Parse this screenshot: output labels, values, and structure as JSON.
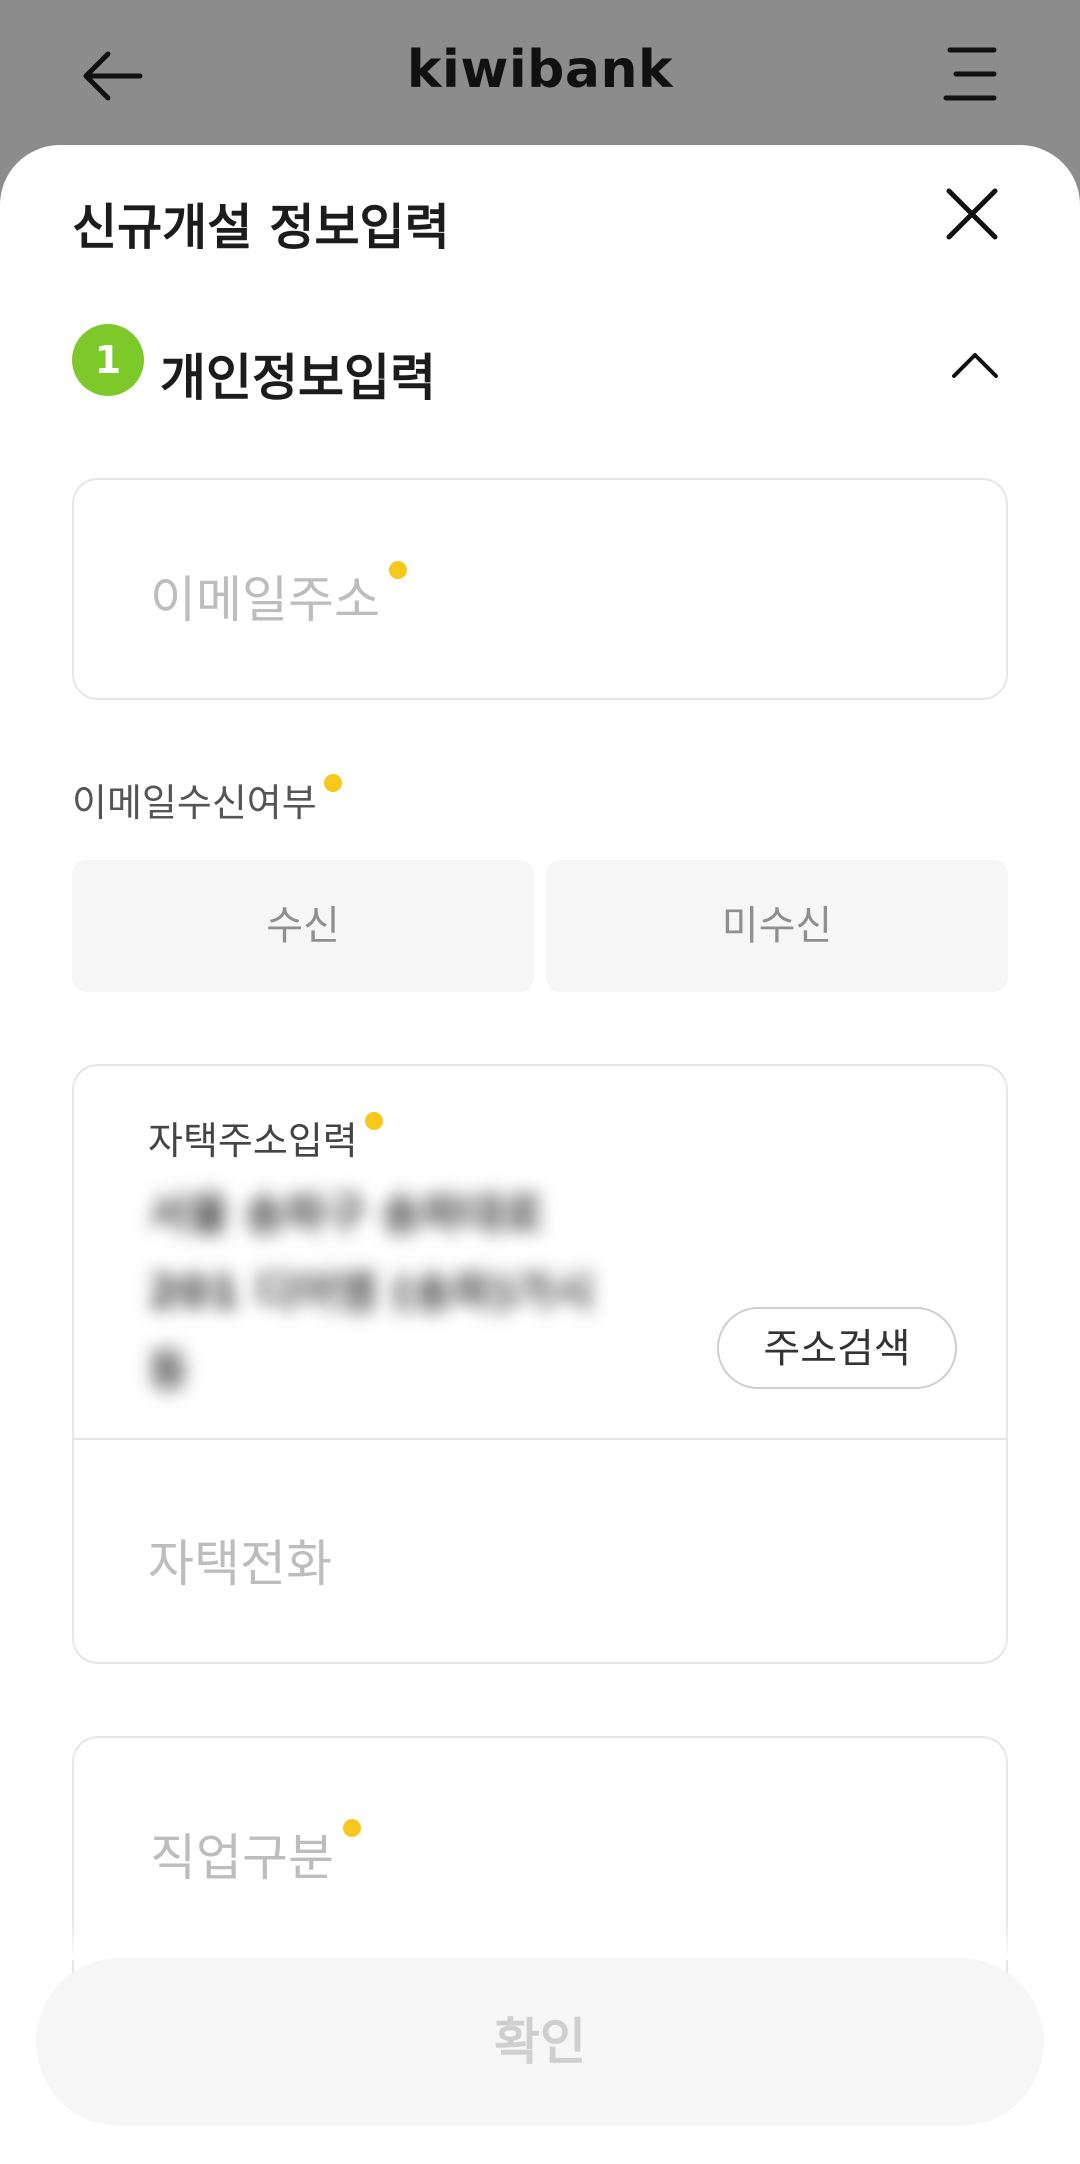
{
  "header": {
    "brand": "kiwibank",
    "back_icon": "arrow-left-icon",
    "menu_icon": "menu-icon"
  },
  "sheet": {
    "title": "신규개설 정보입력",
    "close_icon": "close-icon"
  },
  "section": {
    "step": "1",
    "title": "개인정보입력",
    "collapse_icon": "chevron-up-icon"
  },
  "email": {
    "placeholder": "이메일주소"
  },
  "email_receive": {
    "label": "이메일수신여부",
    "options": [
      "수신",
      "미수신"
    ]
  },
  "address": {
    "label": "자택주소입력",
    "lines": [
      "서울 송파구 송파대로",
      "201 디어엠 (송파)가시",
      "동"
    ],
    "search_button": "주소검색",
    "phone_placeholder": "자택전화"
  },
  "job": {
    "placeholder": "직업구분"
  },
  "confirm_button": "확인",
  "colors": {
    "accent_green": "#7ec92a",
    "required_dot": "#f7c81b",
    "overlay": "#8c8c8c"
  }
}
